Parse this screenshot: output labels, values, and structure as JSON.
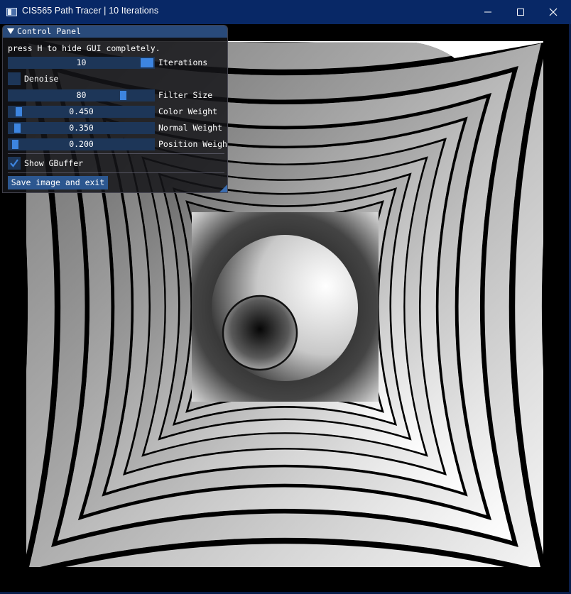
{
  "window": {
    "title": "CIS565 Path Tracer | 10 Iterations",
    "icon": "app-window-icon",
    "controls": [
      "minimize-icon",
      "maximize-icon",
      "close-icon"
    ]
  },
  "control_panel": {
    "title": "Control Panel",
    "hint": "press H to hide GUI completely.",
    "iterations": {
      "value": "10",
      "label": "Iterations",
      "fraction": 1.0
    },
    "denoise": {
      "label": "Denoise",
      "checked": false
    },
    "filter_size": {
      "value": "80",
      "label": "Filter Size",
      "fraction": 0.8
    },
    "color_weight": {
      "value": "0.450",
      "label": "Color Weight",
      "fraction": 0.045
    },
    "normal_weight": {
      "value": "0.350",
      "label": "Normal Weight",
      "fraction": 0.035
    },
    "position_weight": {
      "value": "0.200",
      "label": "Position Weigh",
      "fraction": 0.02
    },
    "show_gbuffer": {
      "label": "Show GBuffer",
      "checked": true
    },
    "save_button": "Save image and exit"
  },
  "render": {
    "description_icon": "gbuffer-render",
    "colors": {
      "light": "#ffffff",
      "dark": "#000000",
      "accent": "#3d85e0",
      "title_bar": "#082866"
    }
  }
}
